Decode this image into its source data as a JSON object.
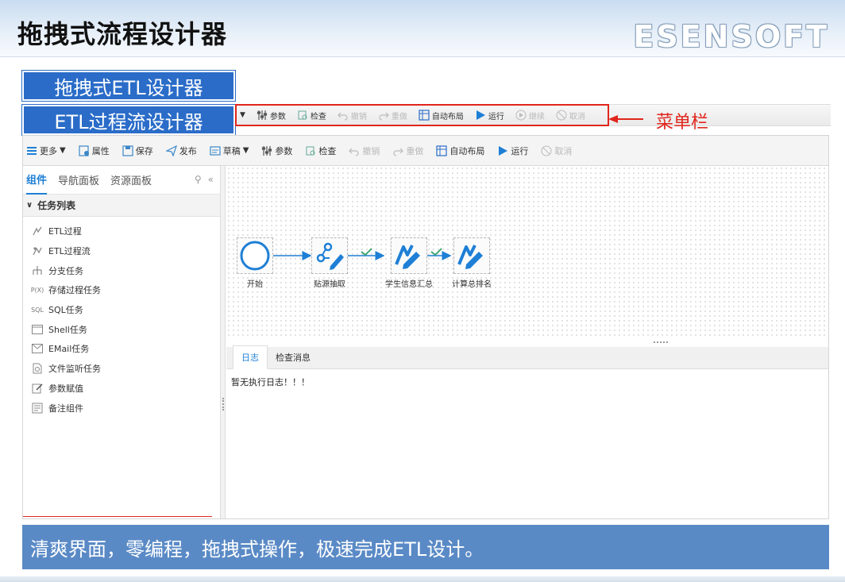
{
  "slide": {
    "title": "拖拽式流程设计器",
    "brand": "ESENSOFT",
    "label_etl": "拖拽式ETL设计器",
    "label_etl_flow": "ETL过程流设计器",
    "callout_label": "菜单栏",
    "banner": "清爽界面，零编程，拖拽式操作，极速完成ETL设计。"
  },
  "top_toolbar": {
    "items": [
      {
        "label": "参数",
        "icon": "params-icon",
        "enabled": true
      },
      {
        "label": "检查",
        "icon": "check-icon",
        "enabled": true
      },
      {
        "label": "撤销",
        "icon": "undo-icon",
        "enabled": false
      },
      {
        "label": "重做",
        "icon": "redo-icon",
        "enabled": false
      },
      {
        "label": "自动布局",
        "icon": "layout-icon",
        "enabled": true
      },
      {
        "label": "运行",
        "icon": "run-icon",
        "enabled": true
      },
      {
        "label": "继续",
        "icon": "continue-icon",
        "enabled": false
      },
      {
        "label": "取消",
        "icon": "cancel-icon",
        "enabled": false
      }
    ]
  },
  "toolbar": {
    "more": "更多",
    "properties": "属性",
    "save": "保存",
    "publish": "发布",
    "draft": "草稿",
    "params": "参数",
    "check": "检查",
    "undo": "撤销",
    "redo": "重做",
    "auto_layout": "自动布局",
    "run": "运行",
    "cancel": "取消"
  },
  "left_panel": {
    "tabs": [
      "组件",
      "导航面板",
      "资源面板"
    ],
    "section": "任务列表",
    "items": [
      {
        "label": "ETL过程",
        "icon": "etl-process-icon"
      },
      {
        "label": "ETL过程流",
        "icon": "etl-flow-icon"
      },
      {
        "label": "分支任务",
        "icon": "branch-icon"
      },
      {
        "label": "存储过程任务",
        "icon": "px-icon",
        "prefix": "P(X)"
      },
      {
        "label": "SQL任务",
        "icon": "sql-icon",
        "prefix": "SQL"
      },
      {
        "label": "Shell任务",
        "icon": "shell-icon"
      },
      {
        "label": "EMail任务",
        "icon": "email-icon"
      },
      {
        "label": "文件监听任务",
        "icon": "file-watch-icon"
      },
      {
        "label": "参数赋值",
        "icon": "param-assign-icon"
      },
      {
        "label": "备注组件",
        "icon": "note-icon"
      }
    ]
  },
  "flow": {
    "nodes": [
      {
        "label": "开始",
        "icon": "start-circle-icon"
      },
      {
        "label": "贴源抽取",
        "icon": "extract-icon"
      },
      {
        "label": "学生信息汇总",
        "icon": "etl-node-icon"
      },
      {
        "label": "计算总排名",
        "icon": "etl-node-icon"
      }
    ]
  },
  "log": {
    "tabs": [
      "日志",
      "检查消息"
    ],
    "message": "暂无执行日志！！！"
  },
  "colors": {
    "accent_blue": "#2a6cc8",
    "flow_blue": "#1e7fd6",
    "callout_red": "#e0261c",
    "banner_blue": "#5a8ac6",
    "check_green": "#35a36b"
  }
}
